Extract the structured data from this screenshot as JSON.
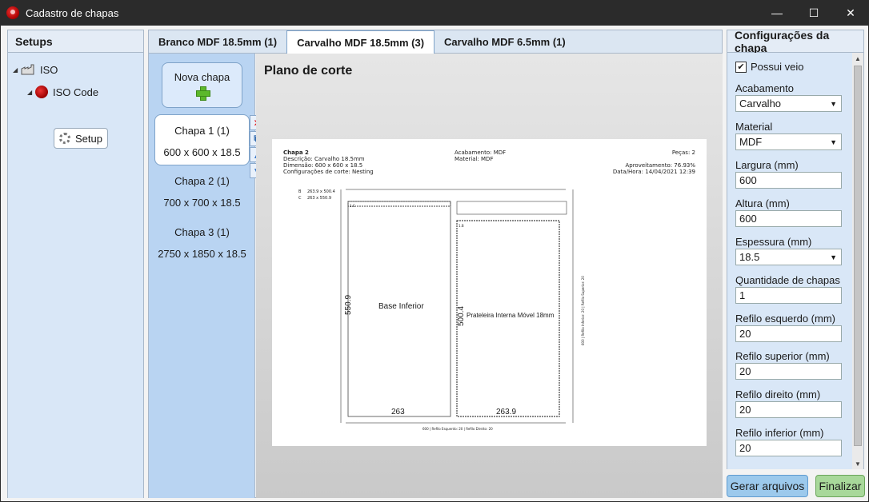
{
  "window": {
    "title": "Cadastro de chapas",
    "controls": [
      "—",
      "☐",
      "✕"
    ]
  },
  "setups": {
    "header": "Setups",
    "tree": {
      "root": "ISO",
      "child": "ISO Code",
      "leaf": "Setup"
    }
  },
  "tabs": [
    {
      "label": "Branco MDF 18.5mm (1)"
    },
    {
      "label": "Carvalho MDF 18.5mm (3)"
    },
    {
      "label": "Carvalho MDF 6.5mm (1)"
    }
  ],
  "sheets": {
    "new_button": "Nova chapa",
    "items": [
      {
        "title": "Chapa 1 (1)",
        "dims": "600 x 600 x 18.5"
      },
      {
        "title": "Chapa 2 (1)",
        "dims": "700 x 700 x 18.5"
      },
      {
        "title": "Chapa 3 (1)",
        "dims": "2750 x 1850 x 18.5"
      }
    ]
  },
  "cut_plan": {
    "title": "Plano de corte",
    "sheet_name": "Chapa 2",
    "desc": "Descrição: Carvalho 18.5mm",
    "dim": "Dimensão: 600 x 600 x 18.5",
    "config": "Configurações de corte: Nesting",
    "finish": "Acabamento: MDF",
    "material": "Material: MDF",
    "pieces": "Peças: 2",
    "usage": "Aproveitamento: 76.93%",
    "datetime": "Data/Hora: 14/04/2021 12:39",
    "legend_b_key": "B",
    "legend_b_val": "263.9 x 500.4",
    "legend_c_key": "C",
    "legend_c_val": "263 x 550.9",
    "piece1_label": "Base Inferior",
    "piece1_height": "550.9",
    "piece1_width": "263",
    "piece1_tag": "1.C",
    "piece2_label": "Prateleira Interna Móvel 18mm",
    "piece2_height": "500.4",
    "piece2_width": "263.9",
    "piece2_tag": "1.B",
    "bottom_note": "600 | Refilo Esquerdo: 20 | Refilo Direito: 20",
    "right_note": "600 | Refilo Inferior: 20 | Refilo Superior: 20"
  },
  "config": {
    "header": "Configurações da chapa",
    "possui_veio": "Possui veio",
    "fields": {
      "acabamento_label": "Acabamento",
      "acabamento_value": "Carvalho",
      "material_label": "Material",
      "material_value": "MDF",
      "largura_label": "Largura (mm)",
      "largura_value": "600",
      "altura_label": "Altura (mm)",
      "altura_value": "600",
      "espessura_label": "Espessura (mm)",
      "espessura_value": "18.5",
      "quantidade_label": "Quantidade de chapas",
      "quantidade_value": "1",
      "refilo_esq_label": "Refilo esquerdo (mm)",
      "refilo_esq_value": "20",
      "refilo_sup_label": "Refilo superior (mm)",
      "refilo_sup_value": "20",
      "refilo_dir_label": "Refilo direito (mm)",
      "refilo_dir_value": "20",
      "refilo_inf_label": "Refilo inferior (mm)",
      "refilo_inf_value": "20"
    }
  },
  "actions": {
    "generate": "Gerar arquivos",
    "finish": "Finalizar"
  }
}
